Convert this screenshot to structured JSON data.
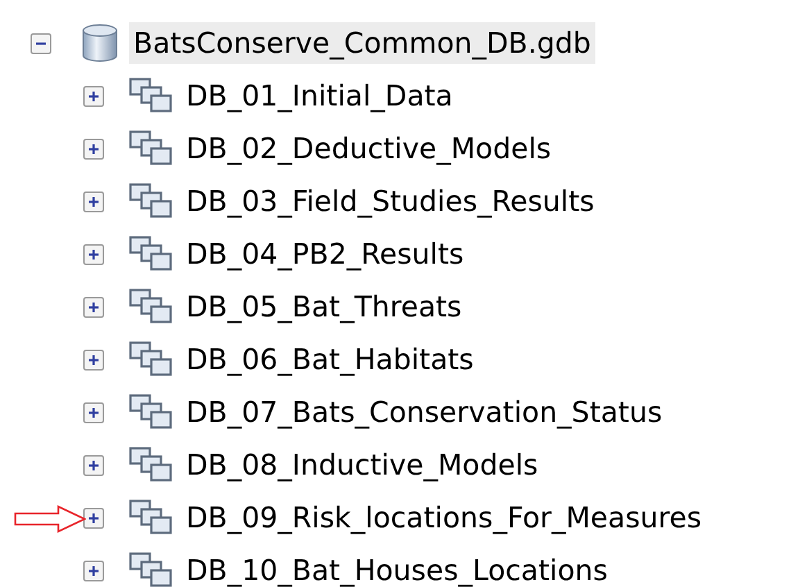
{
  "tree": {
    "label": "BatsConserve_Common_DB.gdb",
    "expanded": true,
    "selected": true,
    "children": [
      {
        "label": "DB_01_Initial_Data",
        "expanded": false,
        "marked": false
      },
      {
        "label": "DB_02_Deductive_Models",
        "expanded": false,
        "marked": false
      },
      {
        "label": "DB_03_Field_Studies_Results",
        "expanded": false,
        "marked": false
      },
      {
        "label": "DB_04_PB2_Results",
        "expanded": false,
        "marked": false
      },
      {
        "label": "DB_05_Bat_Threats",
        "expanded": false,
        "marked": false
      },
      {
        "label": "DB_06_Bat_Habitats",
        "expanded": false,
        "marked": false
      },
      {
        "label": "DB_07_Bats_Conservation_Status",
        "expanded": false,
        "marked": false
      },
      {
        "label": "DB_08_Inductive_Models",
        "expanded": false,
        "marked": false
      },
      {
        "label": "DB_09_Risk_locations_For_Measures",
        "expanded": false,
        "marked": true
      },
      {
        "label": "DB_10_Bat_Houses_Locations",
        "expanded": false,
        "marked": false
      }
    ]
  }
}
